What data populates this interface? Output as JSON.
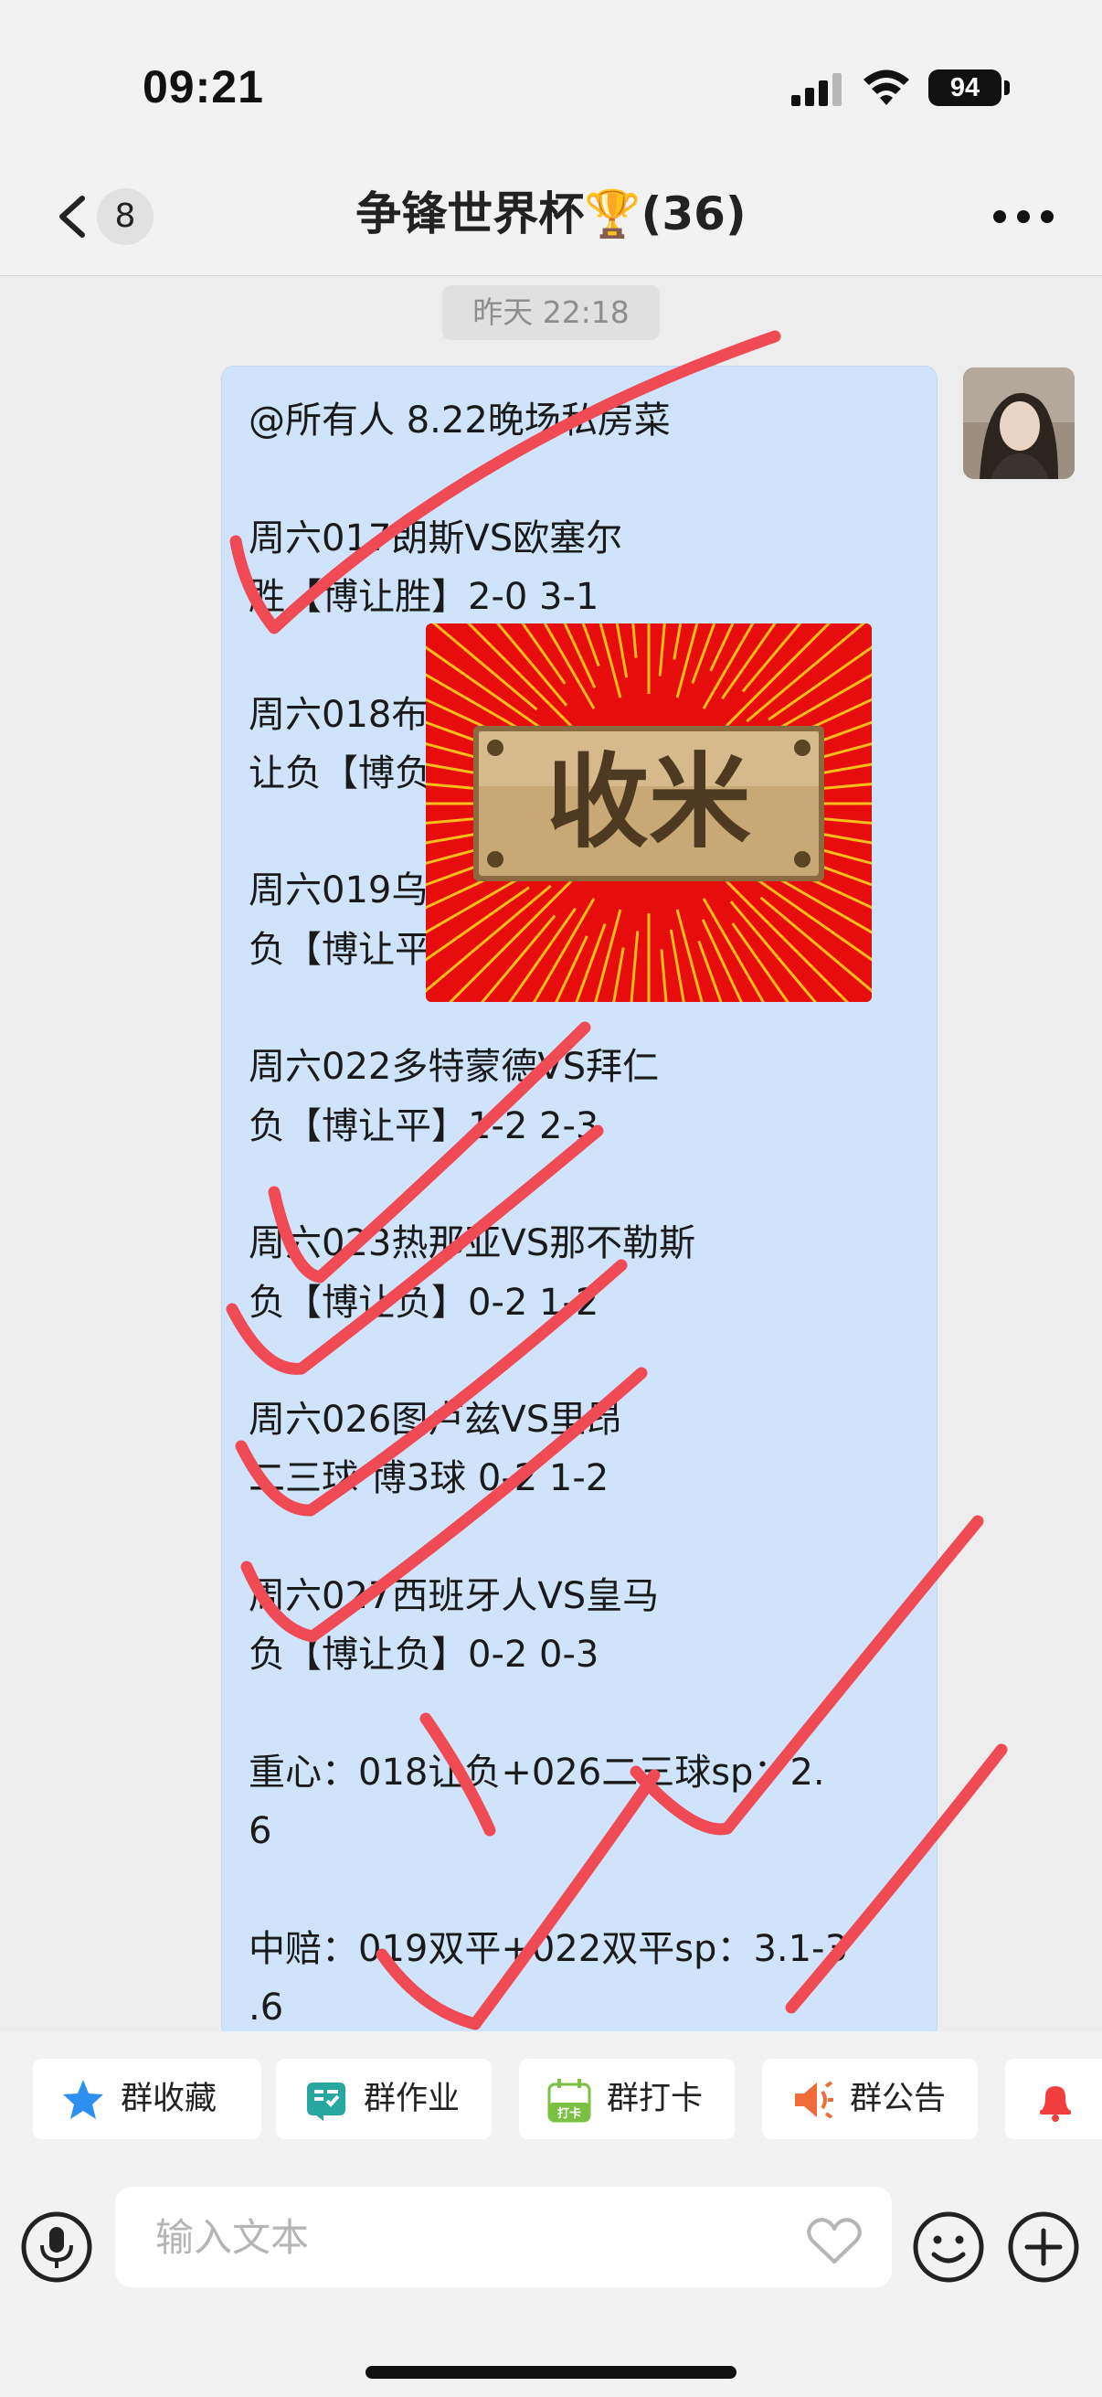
{
  "status_bar": {
    "time": "09:21",
    "battery": "94",
    "icons": [
      "signal-icon",
      "wifi-icon",
      "battery-icon"
    ]
  },
  "nav": {
    "back_badge": "8",
    "title": "争锋世界杯🏆(36)",
    "icons": [
      "chevron-left-icon",
      "more-icon"
    ]
  },
  "chat": {
    "timestamp": "昨天 22:18",
    "message": {
      "lines": [
        "@所有人 8.22晚场私房菜",
        "",
        "周六017朗斯VS欧塞尔",
        "胜【博让胜】2-0 3-1",
        "",
        "周六018布",
        "让负【博负",
        "",
        "周六019乌",
        "负【博让平",
        "",
        "周六022多特蒙德VS拜仁",
        "负【博让平】1-2 2-3",
        "",
        "周六023热那亚VS那不勒斯",
        "负【博让负】0-2 1-2",
        "",
        "周六026图卢兹VS里昂",
        "二三球 博3球 0-2 1-2",
        "",
        "周六027西班牙人VS皇马",
        "负【博让负】0-2 0-3",
        "",
        "重心：018让负+026二三球sp：2.",
        "6",
        "",
        "中赔：019双平+022双平sp：3.1-3",
        ".6"
      ]
    },
    "sticker_text": "收米",
    "check_color": "#f04a55"
  },
  "quick_actions": [
    {
      "label": "群收藏",
      "icon": "star-icon"
    },
    {
      "label": "群作业",
      "icon": "homework-icon"
    },
    {
      "label": "群打卡",
      "icon": "checkin-icon"
    },
    {
      "label": "群公告",
      "icon": "announcement-icon"
    },
    {
      "label": "",
      "icon": "bell-icon"
    }
  ],
  "checkin_icon_text": "打卡",
  "input": {
    "placeholder": "输入文本",
    "icons": [
      "microphone-icon",
      "heart-icon",
      "emoji-icon",
      "plus-icon"
    ]
  }
}
